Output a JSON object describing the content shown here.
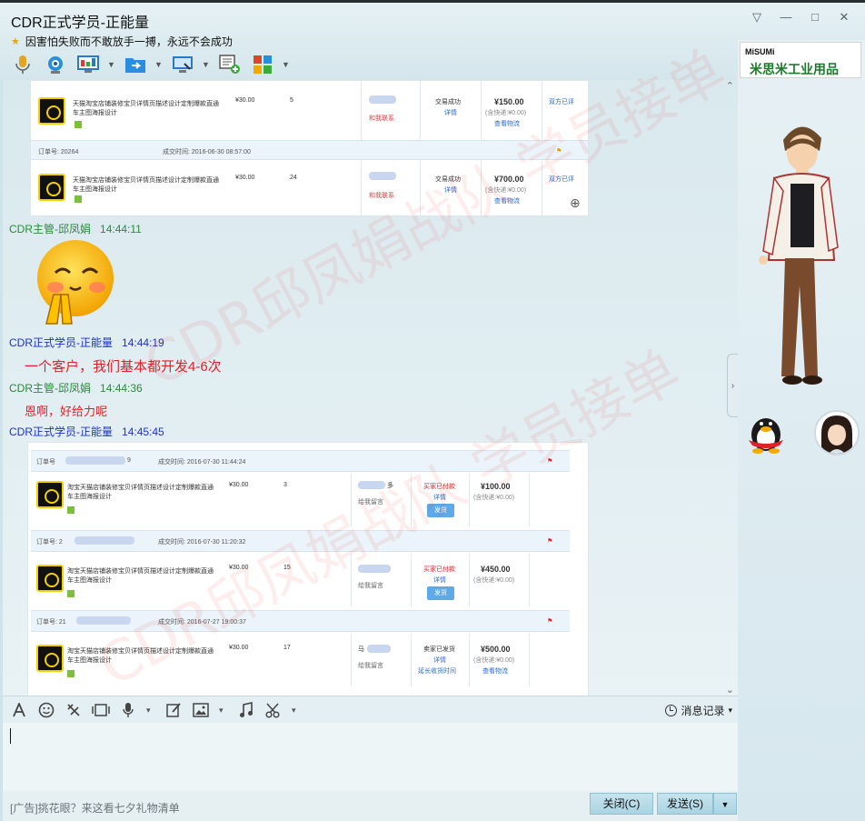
{
  "window": {
    "title": "CDR正式学员-正能量",
    "signature": "因害怕失败而不敢放手一搏，永远不会成功",
    "controls": [
      "▽",
      "—",
      "□",
      "✕"
    ]
  },
  "toolbar": {
    "icons": [
      "microphone-icon",
      "video-camera-icon",
      "screen-share-icon",
      "file-transfer-icon",
      "remote-desktop-icon",
      "new-discussion-icon",
      "apps-grid-icon"
    ]
  },
  "chat": {
    "messages": [
      {
        "sender": "CDR主管-邱凤娟",
        "time": "14:44:11",
        "role": "manager",
        "type": "emoji"
      },
      {
        "sender": "CDR正式学员-正能量",
        "time": "14:44:19",
        "role": "student",
        "type": "text",
        "text": "一个客户，我们基本都开发4-6次"
      },
      {
        "sender": "CDR主管-邱凤娟",
        "time": "14:44:36",
        "role": "manager",
        "type": "text",
        "text": "恩啊，好给力呢"
      },
      {
        "sender": "CDR正式学员-正能量",
        "time": "14:45:45",
        "role": "student",
        "type": "image"
      }
    ],
    "screenshot1": {
      "rows": [
        {
          "title_line1": "天猫淘宝店铺装修宝贝详情页描述设计定制爆款直通",
          "title_line2": "车主图海报设计",
          "price": "¥30.00",
          "qty": "5",
          "contact": "和我联系",
          "status": "交易成功",
          "detail": "详情",
          "total": "¥150.00",
          "shipping": "(含快递:¥0.00)",
          "logistics": "查看物流",
          "review": "双方已评"
        },
        {
          "order_label": "订单号: 20264",
          "deal_time": "成交时间: 2016-06-30 08:57:00",
          "title_line1": "天猫淘宝店铺装修宝贝详情页描述设计定制爆款直通",
          "title_line2": "车主图海报设计",
          "price": "¥30.00",
          "qty": "24",
          "contact": "和我联系",
          "status": "交易成功",
          "detail": "详情",
          "total": "¥700.00",
          "shipping": "(含快递:¥0.00)",
          "logistics": "查看物流",
          "review": "双方已评"
        }
      ]
    },
    "screenshot2": {
      "rows": [
        {
          "order_label": "订单号",
          "order_suffix": "9",
          "deal_time": "成交时间: 2016-07-30 11:44:24",
          "title_line1": "淘宝天猫店铺装修宝贝详情页描述设计定制爆款直通",
          "title_line2": "车主图海报设计",
          "price": "¥30.00",
          "qty": "3",
          "contact_suffix": "多",
          "note": "给我留言",
          "status": "买家已付款",
          "detail": "详情",
          "action": "发货",
          "total": "¥100.00",
          "shipping": "(含快递:¥0.00)"
        },
        {
          "order_label": "订单号: 2",
          "deal_time": "成交时间: 2016-07-30 11:20:32",
          "title_line1": "淘宝天猫店铺装修宝贝详情页描述设计定制爆款直通",
          "title_line2": "车主图海报设计",
          "price": "¥30.00",
          "qty": "15",
          "note": "给我留言",
          "status": "买家已付款",
          "detail": "详情",
          "action": "发货",
          "total": "¥450.00",
          "shipping": "(含快递:¥0.00)"
        },
        {
          "order_label": "订单号: 21",
          "deal_time": "成交时间: 2016-07-27 19:00:37",
          "title_line1": "淘宝天猫店铺装修宝贝详情页描述设计定制爆款直通",
          "title_line2": "车主图海报设计",
          "price": "¥30.00",
          "qty": "17",
          "contact_prefix": "马",
          "note": "给我留言",
          "status": "卖家已发货",
          "detail": "详情",
          "extend": "延长收货时间",
          "total": "¥500.00",
          "shipping": "(含快递:¥0.00)",
          "logistics": "查看物流"
        }
      ]
    },
    "watermark": "CDR邱凤娟战队 学员接单"
  },
  "inputbar": {
    "history_label": "消息记录",
    "icons": [
      "font-icon",
      "emoji-icon",
      "shake-icon",
      "gif-icon",
      "voice-message-icon",
      "handwriting-icon",
      "image-icon",
      "music-icon",
      "screenshot-scissors-icon"
    ]
  },
  "footer": {
    "ad_text": "[广告]挑花眼？来这看七夕礼物清单",
    "close_label": "关闭(C)",
    "send_label": "发送(S)"
  },
  "rightpane": {
    "ad_logo": "MiSUMi",
    "ad_text": "米思米工业用品"
  }
}
